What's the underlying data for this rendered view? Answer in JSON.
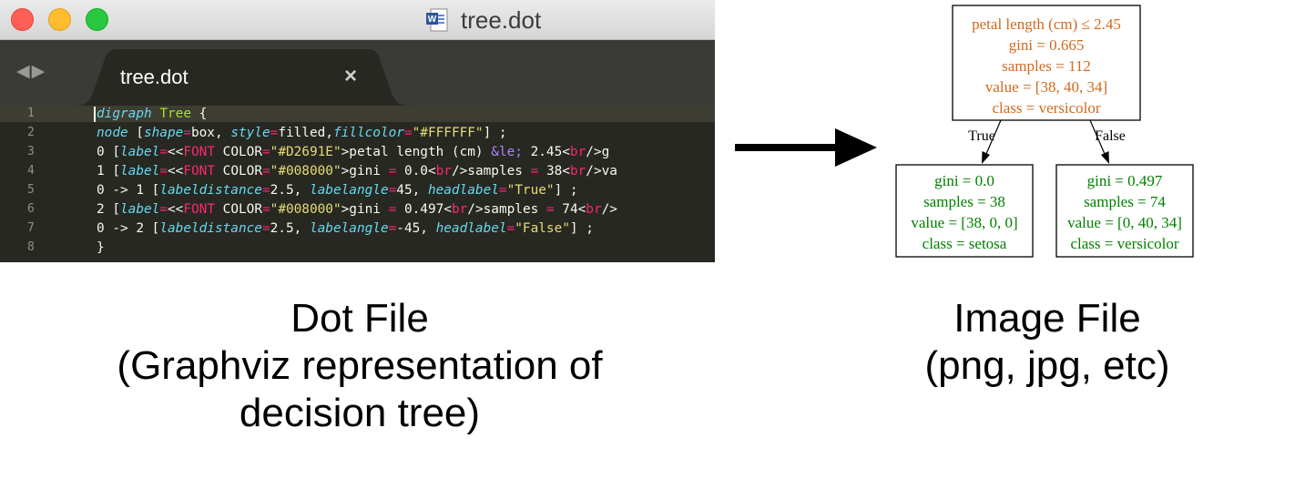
{
  "window": {
    "title": "tree.dot",
    "icon": "word-document-icon",
    "buttons": [
      "close",
      "minimize",
      "zoom"
    ],
    "colors": {
      "close": "#ff5f57",
      "minimize": "#febc2e",
      "zoom": "#28c840"
    }
  },
  "tabs": [
    {
      "label": "tree.dot",
      "close_glyph": "×",
      "active": true
    }
  ],
  "nav": {
    "back": "◀",
    "forward": "▶"
  },
  "editor": {
    "theme_background": "#272822",
    "line_numbers": [
      "1",
      "2",
      "3",
      "4",
      "5",
      "6",
      "7",
      "8"
    ],
    "lines": [
      "digraph Tree {",
      "node [shape=box, style=filled,fillcolor=\"#FFFFFF\"] ;",
      "0 [label=<<FONT COLOR=\"#D2691E\">petal length (cm) &le; 2.45<br/>g",
      "1 [label=<<FONT COLOR=\"#008000\">gini = 0.0<br/>samples = 38<br/>va",
      "0 -> 1 [labeldistance=2.5, labelangle=45, headlabel=\"True\"] ;",
      "2 [label=<<FONT COLOR=\"#008000\">gini = 0.497<br/>samples = 74<br/>",
      "0 -> 2 [labeldistance=2.5, labelangle=-45, headlabel=\"False\"] ;",
      "}"
    ]
  },
  "tree": {
    "root": {
      "color": "#d2691e",
      "lines": [
        "petal length (cm) ≤ 2.45",
        "gini = 0.665",
        "samples = 112",
        "value = [38, 40, 34]",
        "class = versicolor"
      ]
    },
    "left": {
      "color": "#008000",
      "lines": [
        "gini = 0.0",
        "samples = 38",
        "value = [38, 0, 0]",
        "class = setosa"
      ]
    },
    "right": {
      "color": "#008000",
      "lines": [
        "gini = 0.497",
        "samples = 74",
        "value = [0, 40, 34]",
        "class = versicolor"
      ]
    },
    "edge_labels": {
      "left": "True",
      "right": "False"
    }
  },
  "captions": {
    "left": [
      "Dot File",
      "(Graphviz representation of",
      "decision tree)"
    ],
    "right": [
      "Image File",
      "(png, jpg, etc)"
    ]
  }
}
